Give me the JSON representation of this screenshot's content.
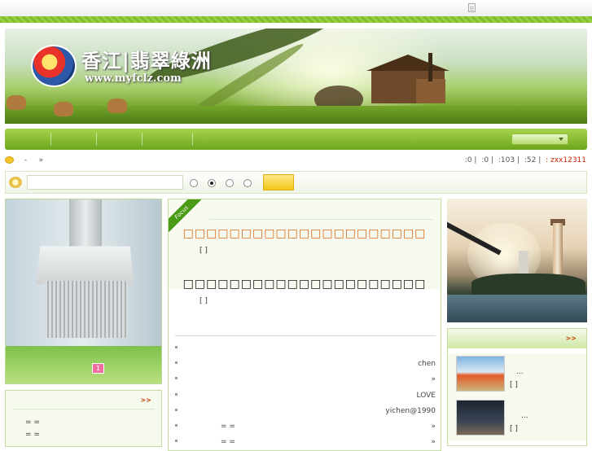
{
  "topbar": {
    "doc_icon": "document-icon"
  },
  "banner": {
    "logo_text": "香江|翡翠綠洲",
    "logo_url": "www.myfclz.com"
  },
  "navbar": {
    "select_value": ""
  },
  "infobar": {
    "crumb_sep": "-",
    "crumb_arrow": "»",
    "stats": [
      ":0",
      ":0",
      ":103",
      ":52"
    ],
    "user": ": zxx12311"
  },
  "search": {
    "placeholder": "",
    "radio_selected": 1
  },
  "left_slide": {
    "page_number": "1"
  },
  "left_box2": {
    "more": ">>",
    "marks": [
      "= =",
      "= ="
    ]
  },
  "center": {
    "focus_label": "Focus",
    "headline1": "□□□□□□□□□□□□□□□□□□□□□",
    "bracket1": "[ ]",
    "headline2": "□□□□□□□□□□□□□□□□□□□□□",
    "bracket2": "[ ]",
    "rows": [
      {
        "right": ""
      },
      {
        "right": "chen"
      },
      {
        "right": "»"
      },
      {
        "right": "LOVE"
      },
      {
        "right": "yichen@1990"
      },
      {
        "mid": "= =",
        "right": "»"
      },
      {
        "mid": "= =",
        "right": "»"
      }
    ]
  },
  "right_box": {
    "more": ">>",
    "items": [
      {
        "title": "...",
        "bracket": "[ ]"
      },
      {
        "title": "...",
        "bracket": "[ ]"
      }
    ]
  },
  "colors": {
    "nav_green": "#8cc63f",
    "accent_orange": "#e06a14",
    "user_red": "#cc2200"
  }
}
